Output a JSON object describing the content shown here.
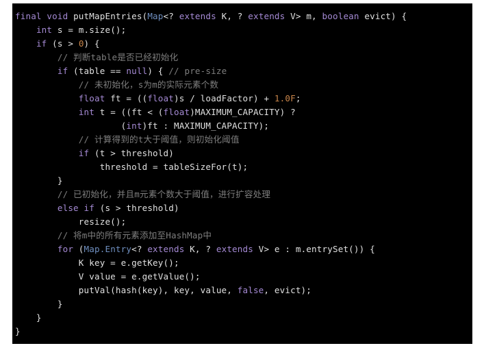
{
  "editor": {
    "language": "java",
    "theme": "dark",
    "background": "#000000",
    "page_background": "#ffffff",
    "colors": {
      "keyword": "#a58ad4",
      "type": "#6f8fc0",
      "number": "#c9854a",
      "comment": "#7e7e7e",
      "plain": "#e0e0e0"
    },
    "title": "putMapEntries",
    "lines": [
      [
        {
          "t": "final",
          "c": "kw"
        },
        {
          "t": " ",
          "c": "pln"
        },
        {
          "t": "void",
          "c": "kw"
        },
        {
          "t": " putMapEntries(",
          "c": "pln"
        },
        {
          "t": "Map",
          "c": "typ"
        },
        {
          "t": "<? ",
          "c": "pln"
        },
        {
          "t": "extends",
          "c": "kw"
        },
        {
          "t": " K, ? ",
          "c": "pln"
        },
        {
          "t": "extends",
          "c": "kw"
        },
        {
          "t": " V> m, ",
          "c": "pln"
        },
        {
          "t": "boolean",
          "c": "kw"
        },
        {
          "t": " evict) {",
          "c": "pln"
        }
      ],
      [
        {
          "t": "    ",
          "c": "pln"
        },
        {
          "t": "int",
          "c": "kw"
        },
        {
          "t": " s = m.size();",
          "c": "pln"
        }
      ],
      [
        {
          "t": "    ",
          "c": "pln"
        },
        {
          "t": "if",
          "c": "kw"
        },
        {
          "t": " (s > ",
          "c": "pln"
        },
        {
          "t": "0",
          "c": "num"
        },
        {
          "t": ") {",
          "c": "pln"
        }
      ],
      [
        {
          "t": "        ",
          "c": "pln"
        },
        {
          "t": "// 判断table是否已经初始化",
          "c": "cmt"
        }
      ],
      [
        {
          "t": "        ",
          "c": "pln"
        },
        {
          "t": "if",
          "c": "kw"
        },
        {
          "t": " (table == ",
          "c": "pln"
        },
        {
          "t": "null",
          "c": "kw"
        },
        {
          "t": ") { ",
          "c": "pln"
        },
        {
          "t": "// pre-size",
          "c": "cmt"
        }
      ],
      [
        {
          "t": "            ",
          "c": "pln"
        },
        {
          "t": "// 未初始化，s为m的实际元素个数",
          "c": "cmt"
        }
      ],
      [
        {
          "t": "            ",
          "c": "pln"
        },
        {
          "t": "float",
          "c": "kw"
        },
        {
          "t": " ft = ((",
          "c": "pln"
        },
        {
          "t": "float",
          "c": "kw"
        },
        {
          "t": ")s / loadFactor) + ",
          "c": "pln"
        },
        {
          "t": "1.0F",
          "c": "num"
        },
        {
          "t": ";",
          "c": "pln"
        }
      ],
      [
        {
          "t": "            ",
          "c": "pln"
        },
        {
          "t": "int",
          "c": "kw"
        },
        {
          "t": " t = ((ft < (",
          "c": "pln"
        },
        {
          "t": "float",
          "c": "kw"
        },
        {
          "t": ")MAXIMUM_CAPACITY) ?",
          "c": "pln"
        }
      ],
      [
        {
          "t": "                    (",
          "c": "pln"
        },
        {
          "t": "int",
          "c": "kw"
        },
        {
          "t": ")ft : MAXIMUM_CAPACITY);",
          "c": "pln"
        }
      ],
      [
        {
          "t": "            ",
          "c": "pln"
        },
        {
          "t": "// 计算得到的t大于阈值，则初始化阈值",
          "c": "cmt"
        }
      ],
      [
        {
          "t": "            ",
          "c": "pln"
        },
        {
          "t": "if",
          "c": "kw"
        },
        {
          "t": " (t > threshold)",
          "c": "pln"
        }
      ],
      [
        {
          "t": "                threshold = tableSizeFor(t);",
          "c": "pln"
        }
      ],
      [
        {
          "t": "        }",
          "c": "pln"
        }
      ],
      [
        {
          "t": "        ",
          "c": "pln"
        },
        {
          "t": "// 已初始化，并且m元素个数大于阈值，进行扩容处理",
          "c": "cmt"
        }
      ],
      [
        {
          "t": "        ",
          "c": "pln"
        },
        {
          "t": "else",
          "c": "kw"
        },
        {
          "t": " ",
          "c": "pln"
        },
        {
          "t": "if",
          "c": "kw"
        },
        {
          "t": " (s > threshold)",
          "c": "pln"
        }
      ],
      [
        {
          "t": "            resize();",
          "c": "pln"
        }
      ],
      [
        {
          "t": "        ",
          "c": "pln"
        },
        {
          "t": "// 将m中的所有元素添加至HashMap中",
          "c": "cmt"
        }
      ],
      [
        {
          "t": "        ",
          "c": "pln"
        },
        {
          "t": "for",
          "c": "kw"
        },
        {
          "t": " (",
          "c": "pln"
        },
        {
          "t": "Map.Entry",
          "c": "typ"
        },
        {
          "t": "<? ",
          "c": "pln"
        },
        {
          "t": "extends",
          "c": "kw"
        },
        {
          "t": " K, ? ",
          "c": "pln"
        },
        {
          "t": "extends",
          "c": "kw"
        },
        {
          "t": " V> e : m.entrySet()) {",
          "c": "pln"
        }
      ],
      [
        {
          "t": "            K key = e.getKey();",
          "c": "pln"
        }
      ],
      [
        {
          "t": "            V value = e.getValue();",
          "c": "pln"
        }
      ],
      [
        {
          "t": "            putVal(hash(key), key, value, ",
          "c": "pln"
        },
        {
          "t": "false",
          "c": "kw"
        },
        {
          "t": ", evict);",
          "c": "pln"
        }
      ],
      [
        {
          "t": "        }",
          "c": "pln"
        }
      ],
      [
        {
          "t": "    }",
          "c": "pln"
        }
      ],
      [
        {
          "t": "}",
          "c": "pln"
        }
      ]
    ]
  }
}
